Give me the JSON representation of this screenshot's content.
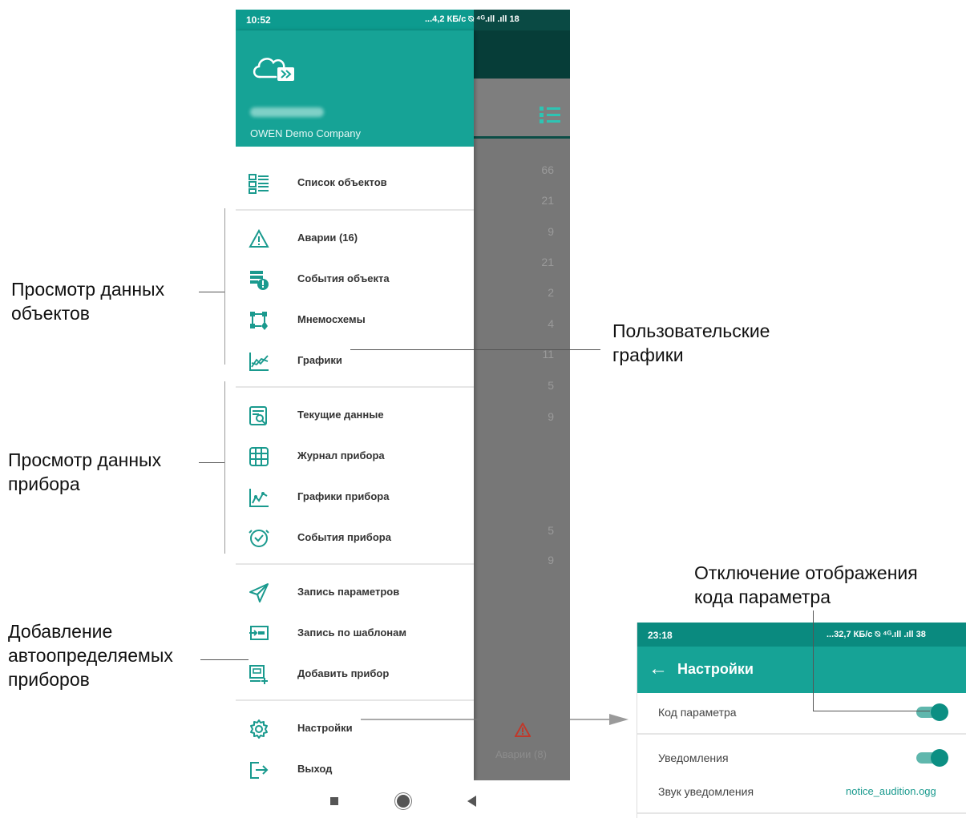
{
  "phone_main": {
    "status_time": "10:52",
    "status_icons": "...4,2 КБ/с ⍉ ⁴ᴳ.ıll .ıll 18",
    "company": "OWEN Demo Company",
    "menu": [
      {
        "label": "Список объектов",
        "icon": "object-list-icon"
      },
      {
        "label": "Аварии (16)",
        "icon": "alarm-triangle-icon"
      },
      {
        "label": "События объекта",
        "icon": "object-events-icon"
      },
      {
        "label": "Мнемосхемы",
        "icon": "mnemonic-scheme-icon"
      },
      {
        "label": "Графики",
        "icon": "chart-icon"
      },
      {
        "label": "Текущие данные",
        "icon": "current-data-icon"
      },
      {
        "label": "Журнал прибора",
        "icon": "device-log-icon"
      },
      {
        "label": "Графики прибора",
        "icon": "device-charts-icon"
      },
      {
        "label": "События прибора",
        "icon": "device-events-icon"
      },
      {
        "label": "Запись параметров",
        "icon": "send-icon"
      },
      {
        "label": "Запись по шаблонам",
        "icon": "template-write-icon"
      },
      {
        "label": "Добавить прибор",
        "icon": "add-device-icon"
      },
      {
        "label": "Настройки",
        "icon": "gear-icon"
      },
      {
        "label": "Выход",
        "icon": "logout-icon"
      }
    ],
    "background_counts": [
      "66",
      "21",
      "9",
      "21",
      "2",
      "4",
      "11",
      "5",
      "9",
      "5",
      "9"
    ],
    "background_alarm_label": "Аварии (8)"
  },
  "annotations": {
    "objects_view": [
      "Просмотр данных",
      "объектов"
    ],
    "device_view": [
      "Просмотр данных",
      "прибора"
    ],
    "add_devices": [
      "Добавление",
      "автоопределяемых",
      "приборов"
    ],
    "user_charts": [
      "Пользовательские",
      "графики"
    ],
    "param_code": [
      "Отключение отображения",
      "кода параметра"
    ]
  },
  "phone_settings": {
    "status_time": "23:18",
    "status_icons": "...32,7 КБ/с ⍉ ⁴ᴳ.ıll .ıll 38",
    "back_arrow": "←",
    "title": "Настройки",
    "rows": {
      "param_code": {
        "label": "Код параметра",
        "enabled": true
      },
      "notifications": {
        "label": "Уведомления",
        "enabled": true
      },
      "sound": {
        "label": "Звук уведомления",
        "value": "notice_audition.ogg"
      }
    }
  },
  "colors": {
    "primary": "#16a396",
    "dark_teal": "#063d38",
    "dim": "#777777"
  }
}
